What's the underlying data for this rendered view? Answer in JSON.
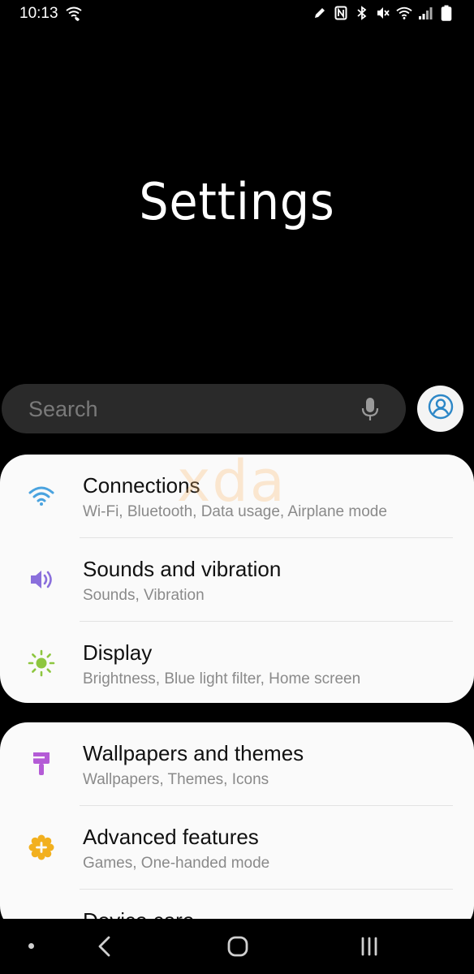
{
  "status_bar": {
    "time": "10:13",
    "icons": [
      "wifi-calling-icon",
      "edit-icon",
      "nfc-icon",
      "bluetooth-icon",
      "mute-icon",
      "wifi-icon",
      "signal-icon",
      "battery-icon"
    ]
  },
  "header": {
    "title": "Settings"
  },
  "search": {
    "placeholder": "Search"
  },
  "watermark": "xda",
  "groups": [
    {
      "items": [
        {
          "title": "Connections",
          "subtitle": "Wi-Fi, Bluetooth, Data usage, Airplane mode",
          "icon": "wifi-icon",
          "color": "#4aa3df"
        },
        {
          "title": "Sounds and vibration",
          "subtitle": "Sounds, Vibration",
          "icon": "speaker-icon",
          "color": "#8a6fdc"
        },
        {
          "title": "Display",
          "subtitle": "Brightness, Blue light filter, Home screen",
          "icon": "brightness-icon",
          "color": "#8dc63f"
        }
      ]
    },
    {
      "items": [
        {
          "title": "Wallpapers and themes",
          "subtitle": "Wallpapers, Themes, Icons",
          "icon": "brush-icon",
          "color": "#b45bd6"
        },
        {
          "title": "Advanced features",
          "subtitle": "Games, One-handed mode",
          "icon": "gear-plus-icon",
          "color": "#f2b01e"
        },
        {
          "title": "Device care",
          "subtitle": "",
          "icon": "device-care-icon",
          "color": "#2cb3a4"
        }
      ]
    }
  ],
  "nav": {
    "icons": [
      "nav-dot-icon",
      "back-icon",
      "home-icon",
      "recents-icon"
    ]
  }
}
